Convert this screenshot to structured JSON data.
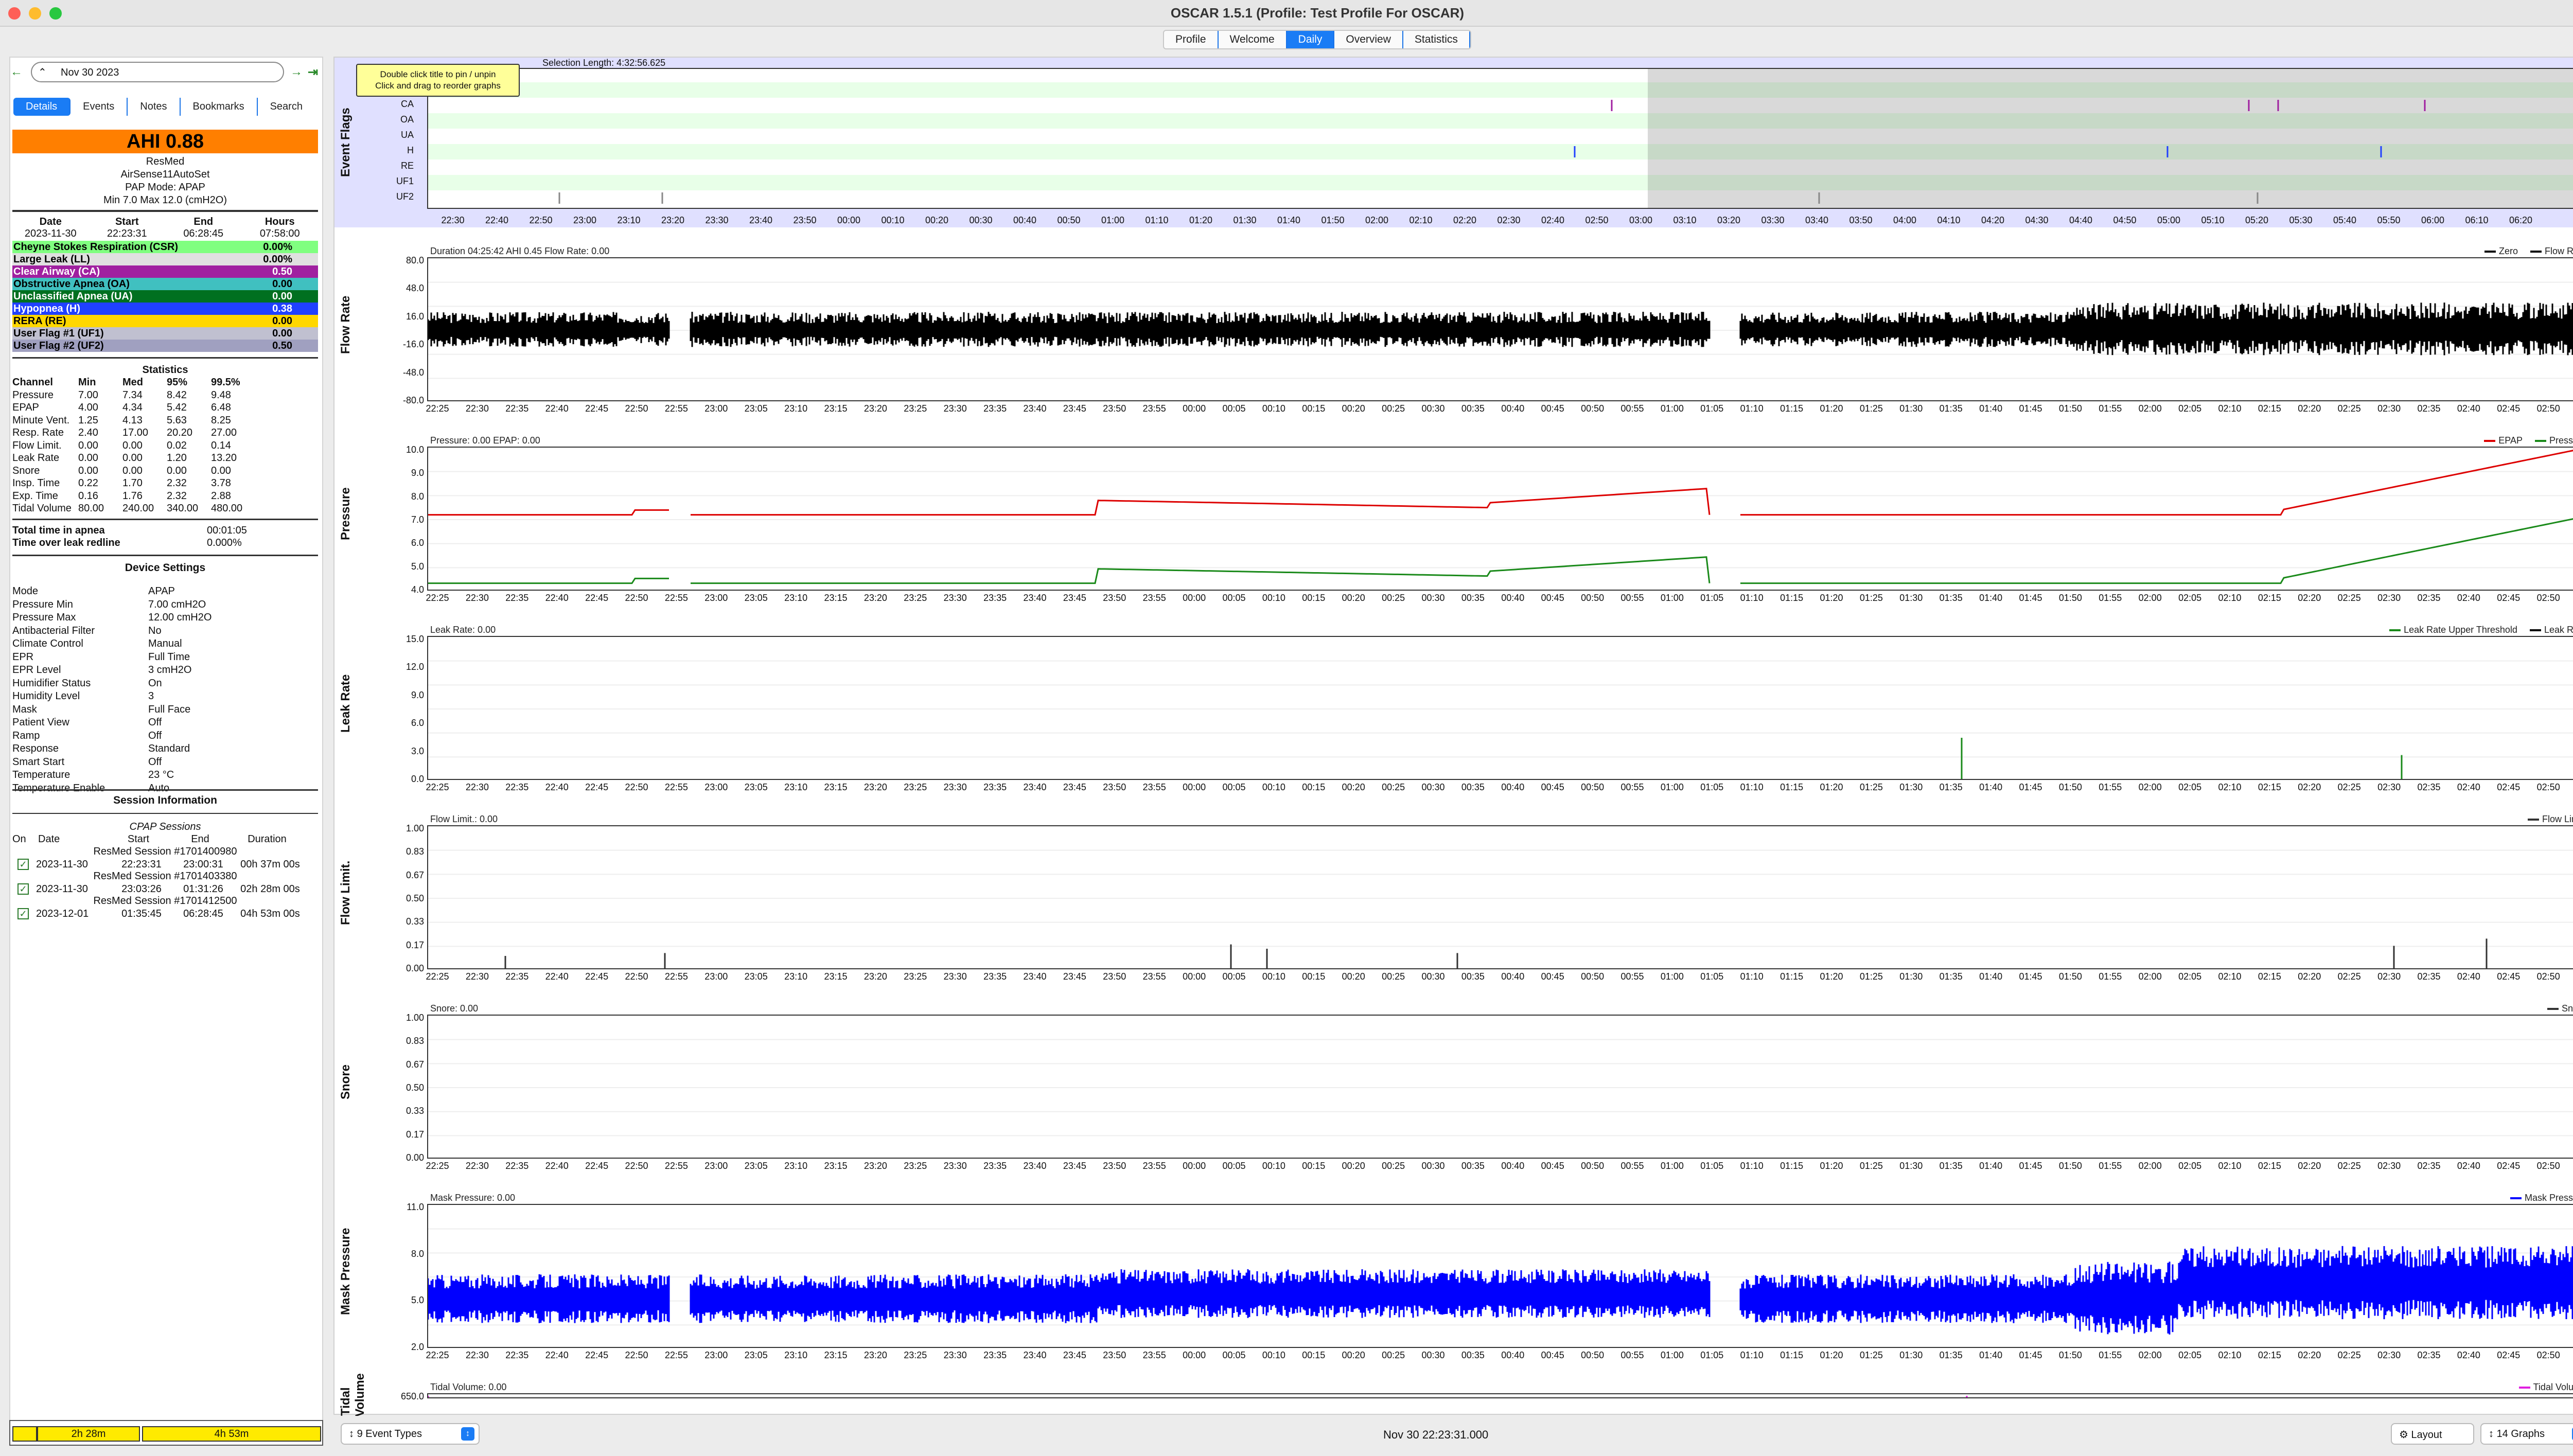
{
  "window": {
    "title": "OSCAR 1.5.1 (Profile: Test Profile For OSCAR)"
  },
  "tabs": [
    "Profile",
    "Welcome",
    "Daily",
    "Overview",
    "Statistics"
  ],
  "active_tab": "Daily",
  "date_nav": {
    "date": "Nov 30 2023"
  },
  "side_tabs": [
    "Details",
    "Events",
    "Notes",
    "Bookmarks",
    "Search"
  ],
  "summary": {
    "ahi": "AHI 0.88",
    "brand": "ResMed",
    "model": "AirSense11AutoSet",
    "mode_line": "PAP Mode: APAP",
    "pressure_line": "Min 7.0 Max 12.0 (cmH2O)"
  },
  "day_table": {
    "headers": [
      "Date",
      "Start",
      "End",
      "Hours"
    ],
    "values": [
      "2023-11-30",
      "22:23:31",
      "06:28:45",
      "07:58:00"
    ]
  },
  "events": [
    {
      "label": "Cheyne Stokes Respiration (CSR)",
      "value": "0.00%",
      "color": "#80ff80",
      "text": "#000"
    },
    {
      "label": "Large Leak (LL)",
      "value": "0.00%",
      "color": "#e0e0e0",
      "text": "#000"
    },
    {
      "label": "Clear Airway (CA)",
      "value": "0.50",
      "color": "#a020a0",
      "text": "#fff"
    },
    {
      "label": "Obstructive Apnea (OA)",
      "value": "0.00",
      "color": "#40c0c0",
      "text": "#000"
    },
    {
      "label": "Unclassified Apnea (UA)",
      "value": "0.00",
      "color": "#007020",
      "text": "#fff"
    },
    {
      "label": "Hypopnea (H)",
      "value": "0.38",
      "color": "#2040ff",
      "text": "#fff"
    },
    {
      "label": "RERA (RE)",
      "value": "0.00",
      "color": "#ffd700",
      "text": "#000"
    },
    {
      "label": "User Flag #1 (UF1)",
      "value": "0.00",
      "color": "#c0c0d0",
      "text": "#000"
    },
    {
      "label": "User Flag #2 (UF2)",
      "value": "0.50",
      "color": "#a0a0c0",
      "text": "#000"
    }
  ],
  "statistics": {
    "title": "Statistics",
    "headers": [
      "Channel",
      "Min",
      "Med",
      "95%",
      "99.5%"
    ],
    "rows": [
      [
        "Pressure",
        "7.00",
        "7.34",
        "8.42",
        "9.48"
      ],
      [
        "EPAP",
        "4.00",
        "4.34",
        "5.42",
        "6.48"
      ],
      [
        "Minute Vent.",
        "1.25",
        "4.13",
        "5.63",
        "8.25"
      ],
      [
        "Resp. Rate",
        "2.40",
        "17.00",
        "20.20",
        "27.00"
      ],
      [
        "Flow Limit.",
        "0.00",
        "0.00",
        "0.02",
        "0.14"
      ],
      [
        "Leak Rate",
        "0.00",
        "0.00",
        "1.20",
        "13.20"
      ],
      [
        "Snore",
        "0.00",
        "0.00",
        "0.00",
        "0.00"
      ],
      [
        "Insp. Time",
        "0.22",
        "1.70",
        "2.32",
        "3.78"
      ],
      [
        "Exp. Time",
        "0.16",
        "1.76",
        "2.32",
        "2.88"
      ],
      [
        "Tidal Volume",
        "80.00",
        "240.00",
        "340.00",
        "480.00"
      ]
    ]
  },
  "apnea_totals": [
    [
      "Total time in apnea",
      "00:01:05"
    ],
    [
      "Time over leak redline",
      "0.000%"
    ]
  ],
  "device_settings": {
    "title": "Device Settings",
    "rows": [
      [
        "Mode",
        "APAP"
      ],
      [
        "Pressure Min",
        "7.00 cmH2O"
      ],
      [
        "Pressure Max",
        "12.00 cmH2O"
      ],
      [
        "Antibacterial Filter",
        "No"
      ],
      [
        "Climate Control",
        "Manual"
      ],
      [
        "EPR",
        "Full Time"
      ],
      [
        "EPR Level",
        "3 cmH2O"
      ],
      [
        "Humidifier Status",
        "On"
      ],
      [
        "Humidity Level",
        "3"
      ],
      [
        "Mask",
        "Full Face"
      ],
      [
        "Patient View",
        "Off"
      ],
      [
        "Ramp",
        "Off"
      ],
      [
        "Response",
        "Standard"
      ],
      [
        "Smart Start",
        "Off"
      ],
      [
        "Temperature",
        "23 °C"
      ],
      [
        "Temperature Enable",
        "Auto"
      ]
    ]
  },
  "session_info": {
    "title": "Session Information",
    "subtitle": "CPAP Sessions",
    "headers": [
      "On",
      "Date",
      "Start",
      "End",
      "Duration"
    ],
    "sessions": [
      {
        "name": "ResMed Session #1701400980",
        "date": "2023-11-30",
        "start": "22:23:31",
        "end": "23:00:31",
        "duration": "00h 37m 00s"
      },
      {
        "name": "ResMed Session #1701403380",
        "date": "2023-11-30",
        "start": "23:03:26",
        "end": "01:31:26",
        "duration": "02h 28m 00s"
      },
      {
        "name": "ResMed Session #1701412500",
        "date": "2023-12-01",
        "start": "01:35:45",
        "end": "06:28:45",
        "duration": "04h 53m 00s"
      }
    ]
  },
  "bottom_bar": {
    "seg1": "2h 28m",
    "seg2": "4h 53m"
  },
  "event_flags_graph": {
    "title": "Event Flags",
    "rows": [
      "LL",
      "CA",
      "OA",
      "UA",
      "H",
      "RE",
      "UF1",
      "UF2"
    ],
    "tooltip_1": "Double click title to pin / unpin",
    "tooltip_2": "Click and drag to reorder graphs",
    "selection": "Selection Length: 4:32:56.625",
    "ticks": [
      "22:30",
      "22:40",
      "22:50",
      "23:00",
      "23:10",
      "23:20",
      "23:30",
      "23:40",
      "23:50",
      "00:00",
      "00:10",
      "00:20",
      "00:30",
      "00:40",
      "00:50",
      "01:00",
      "01:10",
      "01:20",
      "01:30",
      "01:40",
      "01:50",
      "02:00",
      "02:10",
      "02:20",
      "02:30",
      "02:40",
      "02:50",
      "03:00",
      "03:10",
      "03:20",
      "03:30",
      "03:40",
      "03:50",
      "04:00",
      "04:10",
      "04:20",
      "04:30",
      "04:40",
      "04:50",
      "05:00",
      "05:10",
      "05:20",
      "05:30",
      "05:40",
      "05:50",
      "06:00",
      "06:10",
      "06:20"
    ]
  },
  "graphs": [
    {
      "title": "Flow Rate",
      "header": "Duration 04:25:42 AHI 0.45 Flow Rate: 0.00",
      "legend": [
        "Zero",
        "Flow Rate"
      ],
      "yticks": [
        "80.0",
        "48.0",
        "16.0",
        "-16.0",
        "-48.0",
        "-80.0"
      ]
    },
    {
      "title": "Pressure",
      "header": "Pressure: 0.00 EPAP: 0.00",
      "legend": [
        "EPAP",
        "Pressure"
      ],
      "yticks": [
        "10.0",
        "9.0",
        "8.0",
        "7.0",
        "6.0",
        "5.0",
        "4.0"
      ]
    },
    {
      "title": "Leak Rate",
      "header": "Leak Rate: 0.00",
      "legend": [
        "Leak Rate Upper Threshold",
        "Leak Rate"
      ],
      "yticks": [
        "15.0",
        "12.0",
        "9.0",
        "6.0",
        "3.0",
        "0.0"
      ]
    },
    {
      "title": "Flow Limit.",
      "header": "Flow Limit.: 0.00",
      "legend": [
        "Flow Limit."
      ],
      "yticks": [
        "1.00",
        "0.83",
        "0.67",
        "0.50",
        "0.33",
        "0.17",
        "0.00"
      ]
    },
    {
      "title": "Snore",
      "header": "Snore: 0.00",
      "legend": [
        "Snore"
      ],
      "yticks": [
        "1.00",
        "0.83",
        "0.67",
        "0.50",
        "0.33",
        "0.17",
        "0.00"
      ]
    },
    {
      "title": "Mask Pressure",
      "header": "Mask Pressure: 0.00",
      "legend": [
        "Mask Pressure"
      ],
      "yticks": [
        "11.0",
        "8.0",
        "5.0",
        "2.0"
      ]
    },
    {
      "title": "Tidal Volume",
      "header": "Tidal Volume: 0.00",
      "legend": [
        "Tidal Volume"
      ],
      "yticks": [
        "650.0"
      ]
    }
  ],
  "graph_ticks": [
    "22:25",
    "22:30",
    "22:35",
    "22:40",
    "22:45",
    "22:50",
    "22:55",
    "23:00",
    "23:05",
    "23:10",
    "23:15",
    "23:20",
    "23:25",
    "23:30",
    "23:35",
    "23:40",
    "23:45",
    "23:50",
    "23:55",
    "00:00",
    "00:05",
    "00:10",
    "00:15",
    "00:20",
    "00:25",
    "00:30",
    "00:35",
    "00:40",
    "00:45",
    "00:50",
    "00:55",
    "01:00",
    "01:05",
    "01:10",
    "01:15",
    "01:20",
    "01:25",
    "01:30",
    "01:35",
    "01:40",
    "01:45",
    "01:50",
    "01:55",
    "02:00",
    "02:05",
    "02:10",
    "02:15",
    "02:20",
    "02:25",
    "02:30",
    "02:35",
    "02:40",
    "02:45",
    "02:50"
  ],
  "statusbar": {
    "event_types": "9 Event Types",
    "time": "Nov 30 22:23:31.000",
    "layout": "Layout",
    "graphs": "14 Graphs"
  }
}
